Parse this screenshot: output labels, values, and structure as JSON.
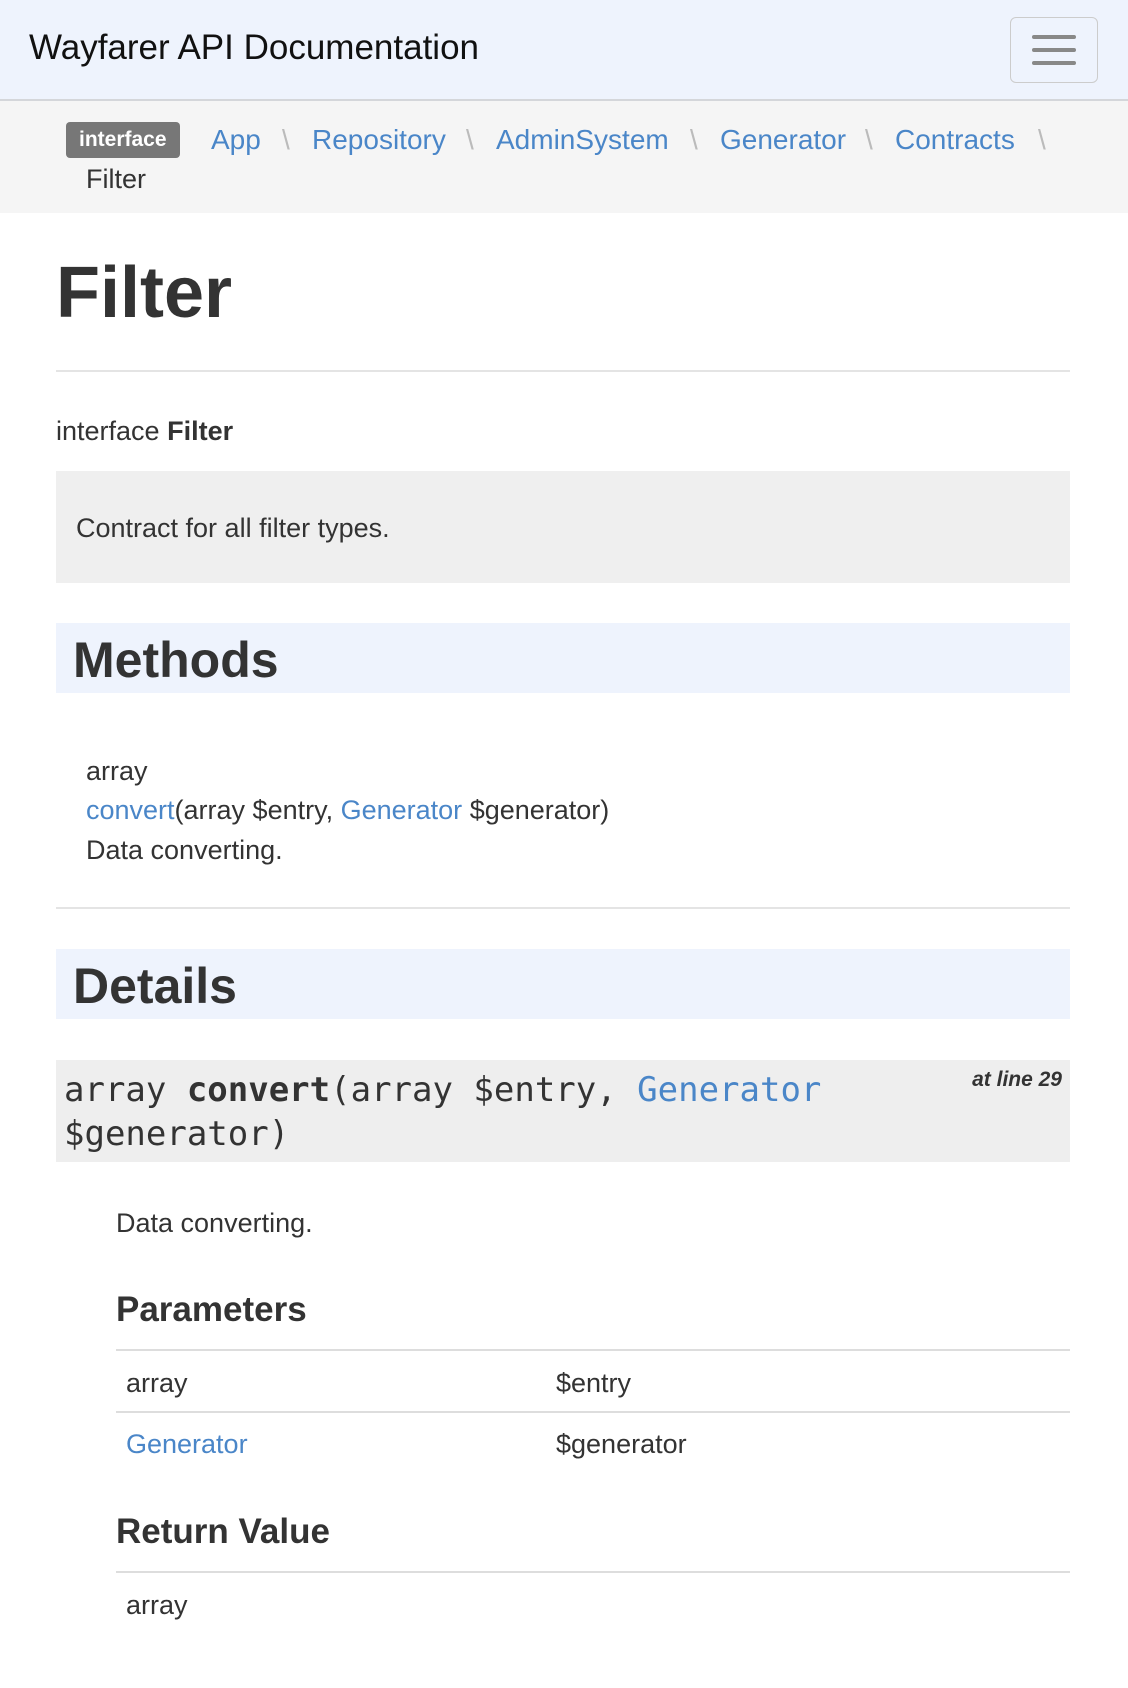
{
  "header": {
    "title": "Wayfarer API Documentation",
    "menu_icon": "hamburger-icon"
  },
  "breadcrumb": {
    "badge": "interface",
    "items": [
      "App",
      "Repository",
      "AdminSystem",
      "Generator",
      "Contracts"
    ],
    "separator": "\\",
    "current": "Filter"
  },
  "page": {
    "title": "Filter",
    "kind_prefix": "interface",
    "kind_name": "Filter",
    "description": "Contract for all filter types."
  },
  "methods": {
    "heading": "Methods",
    "items": [
      {
        "return_type": "array",
        "name": "convert",
        "sig_open": "(array $entry, ",
        "param_type": "Generator",
        "sig_close": " $generator)",
        "summary": "Data converting."
      }
    ]
  },
  "details": {
    "heading": "Details",
    "signature": {
      "return_type": "array ",
      "name": "convert",
      "args_pre": "(array $entry, ",
      "param_type": "Generator",
      "args_post": "$generator)"
    },
    "at_line": "at line 29",
    "description": "Data converting.",
    "parameters_heading": "Parameters",
    "parameters": [
      {
        "type": "array",
        "name": "$entry"
      },
      {
        "type": "Generator",
        "name": "$generator"
      }
    ],
    "return_heading": "Return Value",
    "return_type": "array"
  }
}
